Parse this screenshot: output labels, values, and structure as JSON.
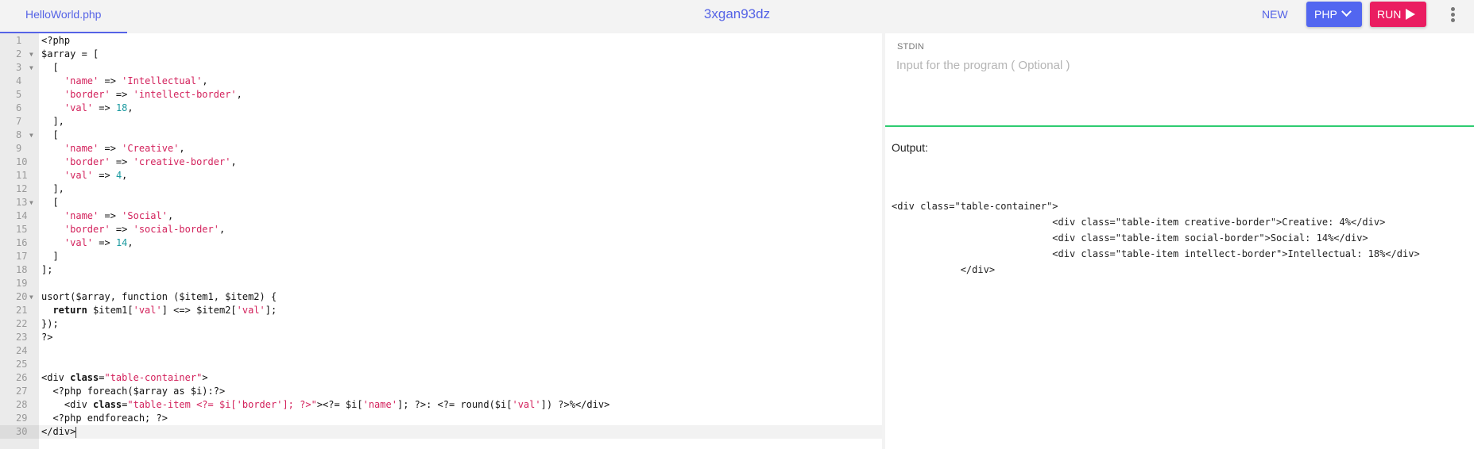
{
  "header": {
    "file_tab": "HelloWorld.php",
    "title": "3xgan93dz",
    "new_label": "NEW",
    "language_label": "PHP",
    "run_label": "RUN",
    "language_icon": "chevron-down-icon",
    "run_icon": "play-icon",
    "menu_icon": "more-vertical-icon"
  },
  "colors": {
    "accent": "#5563e6",
    "run": "#ea1d61",
    "language_button": "#5266f0",
    "divider": "#2ecc71",
    "string": "#d3225c",
    "number": "#1b9aa0"
  },
  "editor": {
    "active_line": 30,
    "lines": [
      {
        "n": "1",
        "fold": false,
        "html": "&lt;?php"
      },
      {
        "n": "2",
        "fold": true,
        "html": "$array = ["
      },
      {
        "n": "3",
        "fold": true,
        "html": "  ["
      },
      {
        "n": "4",
        "fold": false,
        "html": "    <span class='s'>'name'</span> =&gt; <span class='s'>'Intellectual'</span>,"
      },
      {
        "n": "5",
        "fold": false,
        "html": "    <span class='s'>'border'</span> =&gt; <span class='s'>'intellect-border'</span>,"
      },
      {
        "n": "6",
        "fold": false,
        "html": "    <span class='s'>'val'</span> =&gt; <span class='n'>18</span>,"
      },
      {
        "n": "7",
        "fold": false,
        "html": "  ],"
      },
      {
        "n": "8",
        "fold": true,
        "html": "  ["
      },
      {
        "n": "9",
        "fold": false,
        "html": "    <span class='s'>'name'</span> =&gt; <span class='s'>'Creative'</span>,"
      },
      {
        "n": "10",
        "fold": false,
        "html": "    <span class='s'>'border'</span> =&gt; <span class='s'>'creative-border'</span>,"
      },
      {
        "n": "11",
        "fold": false,
        "html": "    <span class='s'>'val'</span> =&gt; <span class='n'>4</span>,"
      },
      {
        "n": "12",
        "fold": false,
        "html": "  ],"
      },
      {
        "n": "13",
        "fold": true,
        "html": "  ["
      },
      {
        "n": "14",
        "fold": false,
        "html": "    <span class='s'>'name'</span> =&gt; <span class='s'>'Social'</span>,"
      },
      {
        "n": "15",
        "fold": false,
        "html": "    <span class='s'>'border'</span> =&gt; <span class='s'>'social-border'</span>,"
      },
      {
        "n": "16",
        "fold": false,
        "html": "    <span class='s'>'val'</span> =&gt; <span class='n'>14</span>,"
      },
      {
        "n": "17",
        "fold": false,
        "html": "  ]"
      },
      {
        "n": "18",
        "fold": false,
        "html": "];"
      },
      {
        "n": "19",
        "fold": false,
        "html": ""
      },
      {
        "n": "20",
        "fold": true,
        "html": "usort($array, function ($item1, $item2) {"
      },
      {
        "n": "21",
        "fold": false,
        "html": "  <span class='k'>return</span> $item1[<span class='s'>'val'</span>] &lt;=&gt; $item2[<span class='s'>'val'</span>];"
      },
      {
        "n": "22",
        "fold": false,
        "html": "});"
      },
      {
        "n": "23",
        "fold": false,
        "html": "?&gt;"
      },
      {
        "n": "24",
        "fold": false,
        "html": ""
      },
      {
        "n": "25",
        "fold": false,
        "html": ""
      },
      {
        "n": "26",
        "fold": false,
        "html": "&lt;div <span class='k'>class</span>=<span class='s'>\"table-container\"</span>&gt;"
      },
      {
        "n": "27",
        "fold": false,
        "html": "  &lt;?php foreach($array as $i):?&gt;"
      },
      {
        "n": "28",
        "fold": false,
        "html": "    &lt;div <span class='k'>class</span>=<span class='s'>\"table-item &lt;?= $i['border']; ?&gt;\"</span>&gt;&lt;?= $i[<span class='s'>'name'</span>]; ?&gt;: &lt;?= round($i[<span class='s'>'val'</span>]) ?&gt;%&lt;/div&gt;"
      },
      {
        "n": "29",
        "fold": false,
        "html": "  &lt;?php endforeach; ?&gt;"
      },
      {
        "n": "30",
        "fold": false,
        "html": "&lt;/div&gt;<span class='cursor'></span>"
      }
    ]
  },
  "stdin": {
    "label": "STDIN",
    "placeholder": "Input for the program ( Optional )",
    "value": ""
  },
  "output": {
    "label": "Output:",
    "text": "<div class=\"table-container\">\n\t\t\t\t\t\t\t<div class=\"table-item creative-border\">Creative: 4%</div>\n\t\t\t\t\t\t\t<div class=\"table-item social-border\">Social: 14%</div>\n\t\t\t\t\t\t\t<div class=\"table-item intellect-border\">Intellectual: 18%</div>\n\t\t\t</div>"
  }
}
